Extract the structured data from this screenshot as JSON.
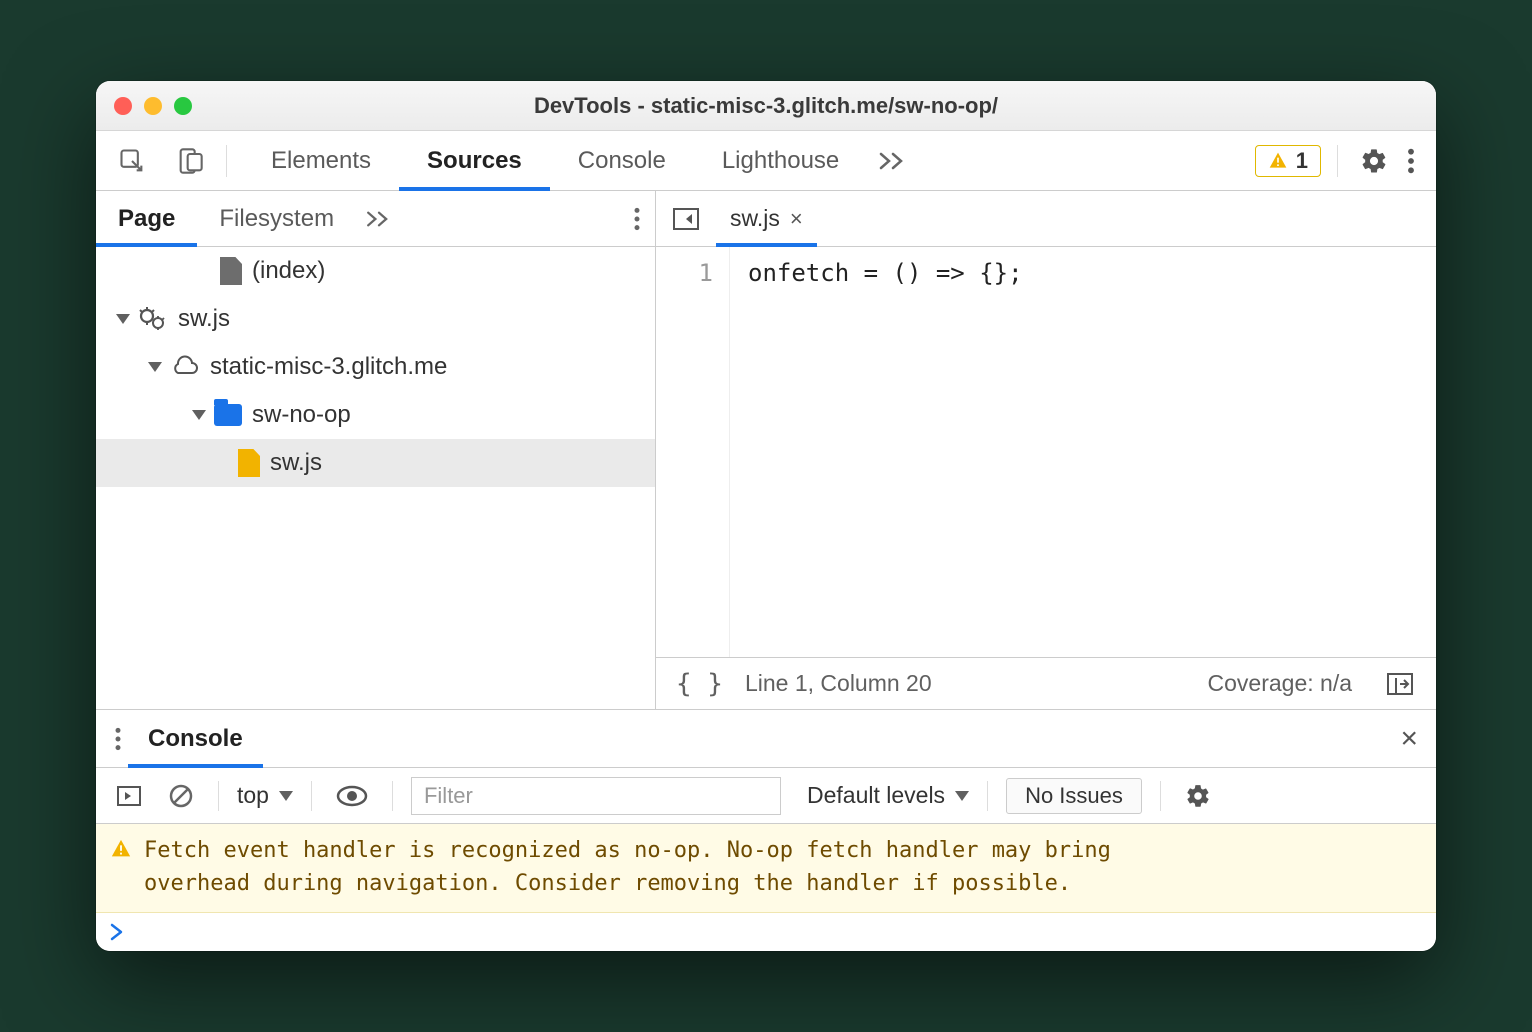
{
  "window": {
    "title": "DevTools - static-misc-3.glitch.me/sw-no-op/"
  },
  "toolbar": {
    "tabs": [
      "Elements",
      "Sources",
      "Console",
      "Lighthouse"
    ],
    "active_tab": "Sources",
    "warnings_count": "1"
  },
  "sidebar": {
    "tabs": [
      "Page",
      "Filesystem"
    ],
    "active_tab": "Page",
    "tree": {
      "index_label": "(index)",
      "sw_worker": "sw.js",
      "origin": "static-misc-3.glitch.me",
      "folder": "sw-no-op",
      "file": "sw.js"
    }
  },
  "editor": {
    "tab_label": "sw.js",
    "line_number": "1",
    "code_line": "onfetch = () => {};",
    "status_position": "Line 1, Column 20",
    "coverage": "Coverage: n/a"
  },
  "drawer": {
    "tab": "Console"
  },
  "console_toolbar": {
    "context": "top",
    "filter_placeholder": "Filter",
    "levels": "Default levels",
    "issues_button": "No Issues"
  },
  "console": {
    "warning": "Fetch event handler is recognized as no-op. No-op fetch handler may bring overhead during navigation. Consider removing the handler if possible."
  }
}
